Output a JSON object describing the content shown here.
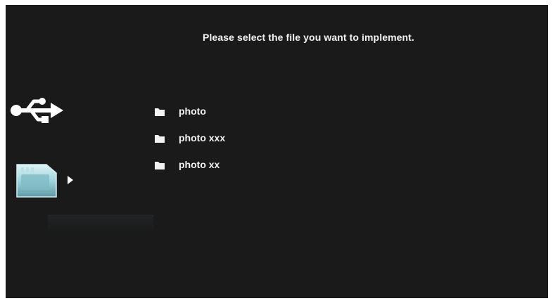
{
  "prompt": "Please select the file you want to implement.",
  "sources": [
    {
      "icon": "usb-icon"
    },
    {
      "icon": "memory-card-icon",
      "selected": true
    }
  ],
  "files": [
    {
      "icon": "folder-icon",
      "label": "photo"
    },
    {
      "icon": "folder-icon",
      "label": "photo xxx"
    },
    {
      "icon": "folder-icon",
      "label": "photo xx"
    }
  ],
  "colors": {
    "background": "#1a1a1a",
    "text": "#f2f2f2",
    "card_accent": "#8ec9d2"
  }
}
